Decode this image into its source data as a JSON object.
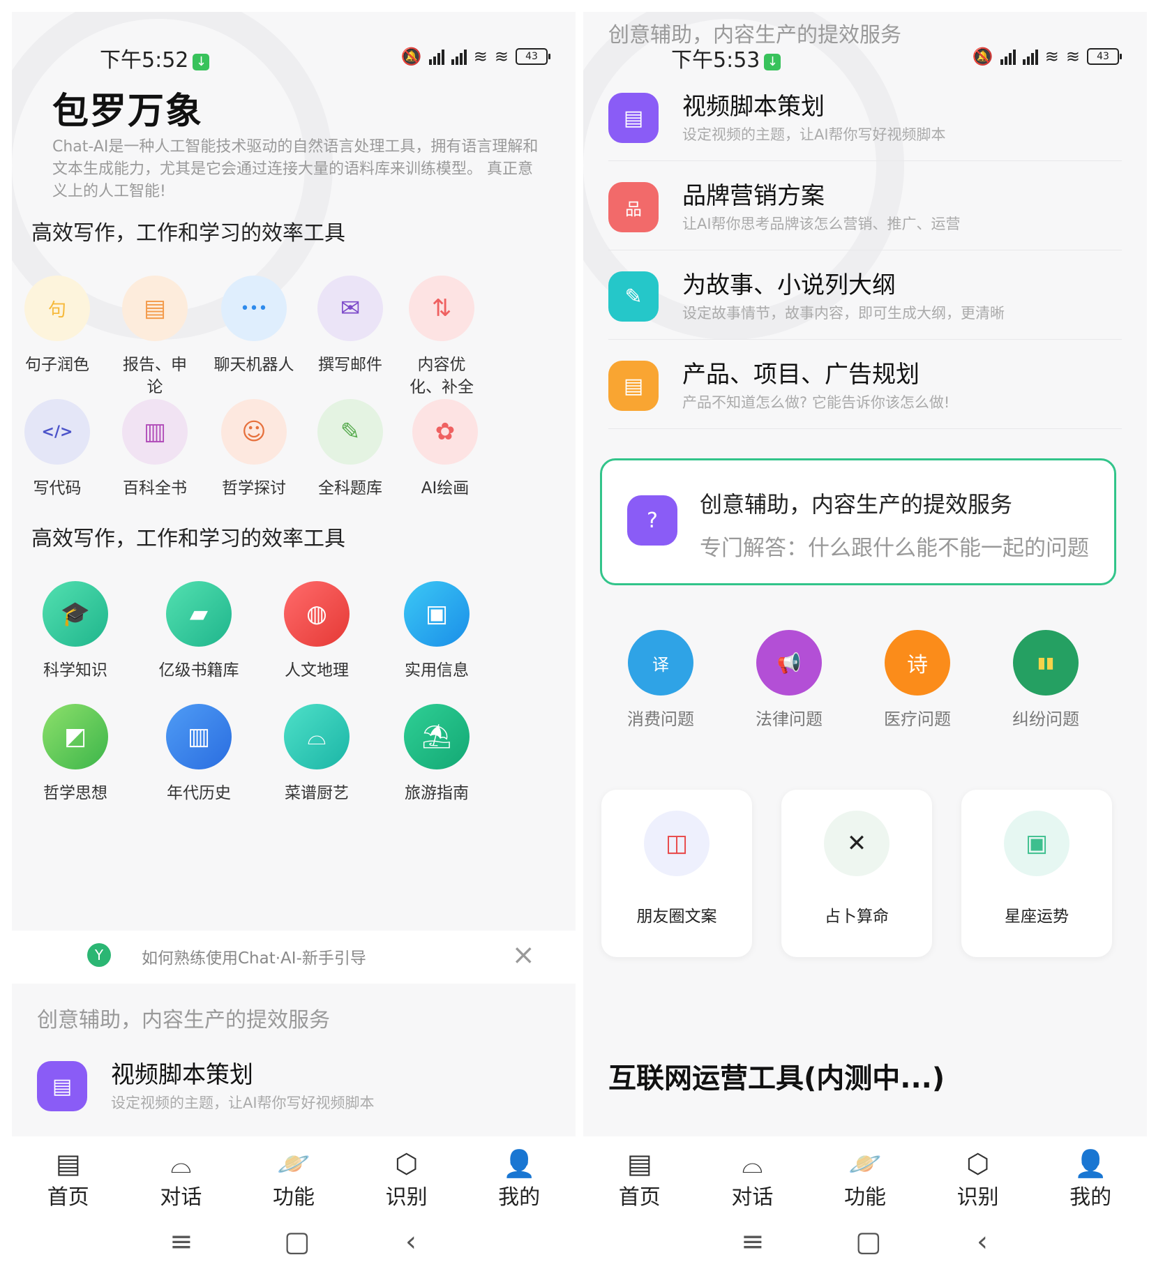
{
  "left": {
    "status": {
      "time": "下午5:52",
      "battery": "43"
    },
    "hero": {
      "title": "包罗万象",
      "desc": "Chat-AI是一种人工智能技术驱动的自然语言处理工具，拥有语言理解和文本生成能力，尤其是它会通过连接大量的语料库来训练模型。 真正意义上的人工智能!"
    },
    "section1": {
      "title": "高效写作，工作和学习的效率工具",
      "items": [
        {
          "label": "句子润色",
          "glyph": "句"
        },
        {
          "label": "报告、申论",
          "glyph": "▤"
        },
        {
          "label": "聊天机器人",
          "glyph": "•••"
        },
        {
          "label": "撰写邮件",
          "glyph": "✉"
        },
        {
          "label": "内容优化、补全",
          "glyph": "⇅"
        },
        {
          "label": "写代码",
          "glyph": "</>"
        },
        {
          "label": "百科全书",
          "glyph": "▥"
        },
        {
          "label": "哲学探讨",
          "glyph": "☺"
        },
        {
          "label": "全科题库",
          "glyph": "✎"
        },
        {
          "label": "AI绘画",
          "glyph": "✿"
        }
      ]
    },
    "section2": {
      "title": "高效写作，工作和学习的效率工具",
      "items": [
        {
          "label": "科学知识",
          "glyph": "🎓"
        },
        {
          "label": "亿级书籍库",
          "glyph": "▰"
        },
        {
          "label": "人文地理",
          "glyph": "◍"
        },
        {
          "label": "实用信息",
          "glyph": "▣"
        },
        {
          "label": "哲学思想",
          "glyph": "◩"
        },
        {
          "label": "年代历史",
          "glyph": "▥"
        },
        {
          "label": "菜谱厨艺",
          "glyph": "⌓"
        },
        {
          "label": "旅游指南",
          "glyph": "⛱"
        }
      ]
    },
    "guide": {
      "text": "如何熟练使用Chat·AI-新手引导",
      "close": "×"
    },
    "creative": {
      "title": "创意辅助，内容生产的提效服务"
    },
    "plan": {
      "title": "视频脚本策划",
      "sub": "设定视频的主题，让AI帮你写好视频脚本"
    }
  },
  "right": {
    "status": {
      "time": "下午5:53",
      "battery": "43"
    },
    "header_overlay": "创意辅助，内容生产的提效服务",
    "plans": [
      {
        "title": "视频脚本策划",
        "sub": "设定视频的主题，让AI帮你写好视频脚本",
        "glyph": "▤",
        "color": "#8a5cf6"
      },
      {
        "title": "品牌营销方案",
        "sub": "让AI帮你思考品牌该怎么营销、推广、运营",
        "glyph": "品",
        "color": "#f26a6a"
      },
      {
        "title": "为故事、小说列大纲",
        "sub": "设定故事情节，故事内容，即可生成大纲，更清晰",
        "glyph": "✎",
        "color": "#25c7c9"
      },
      {
        "title": "产品、项目、广告规划",
        "sub": "产品不知道怎么做? 它能告诉你该怎么做!",
        "glyph": "▤",
        "color": "#f9a532"
      }
    ],
    "ask": {
      "title": "创意辅助，内容生产的提效服务",
      "sub": "专门解答：什么跟什么能不能一起的问题"
    },
    "issues": [
      {
        "label": "消费问题",
        "glyph": "译",
        "color": "#2fa3e6"
      },
      {
        "label": "法律问题",
        "glyph": "📢",
        "color": "#b34fd6"
      },
      {
        "label": "医疗问题",
        "glyph": "诗",
        "color": "#fb8c1a"
      },
      {
        "label": "纠纷问题",
        "glyph": "▮▮",
        "color": "#25a062"
      }
    ],
    "cards": [
      {
        "label": "朋友圈文案",
        "glyph": "◫"
      },
      {
        "label": "占卜算命",
        "glyph": "✕"
      },
      {
        "label": "星座运势",
        "glyph": "▣"
      }
    ],
    "internet_title": "互联网运营工具(内测中...)"
  },
  "tabs": [
    {
      "label": "首页",
      "icon": "home-icon"
    },
    {
      "label": "对话",
      "icon": "chat-icon"
    },
    {
      "label": "功能",
      "icon": "planet-icon"
    },
    {
      "label": "识别",
      "icon": "scan-icon"
    },
    {
      "label": "我的",
      "icon": "user-icon"
    }
  ],
  "colors": {
    "accent_green": "#32c48a",
    "purple": "#8a5cf6"
  }
}
